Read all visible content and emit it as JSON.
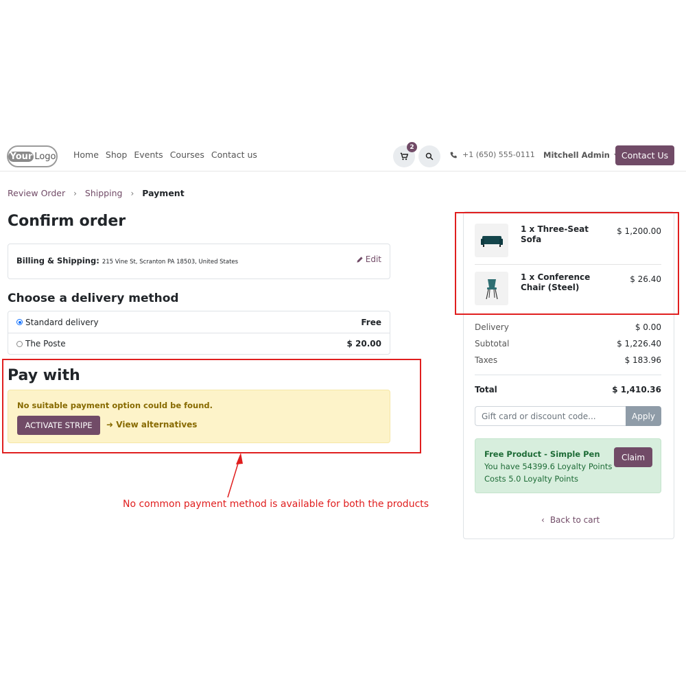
{
  "header": {
    "logo_text_a": "Your",
    "logo_text_b": "Logo",
    "nav": [
      "Home",
      "Shop",
      "Events",
      "Courses",
      "Contact us"
    ],
    "cart_count": "2",
    "phone": "+1 (650) 555-0111",
    "user": "Mitchell Admin",
    "contact_button": "Contact Us",
    "accent_color": "#714b67"
  },
  "breadcrumb": {
    "step1": "Review Order",
    "step2": "Shipping",
    "step3": "Payment"
  },
  "confirm": {
    "title": "Confirm order",
    "billing_label": "Billing & Shipping:",
    "billing_address": "215 Vine St, Scranton PA 18503, United States",
    "edit": "Edit"
  },
  "delivery": {
    "title": "Choose a delivery method",
    "methods": [
      {
        "name": "Standard delivery",
        "price": "Free",
        "selected": true
      },
      {
        "name": "The Poste",
        "price": "$ 20.00",
        "selected": false
      }
    ]
  },
  "payment": {
    "title": "Pay with",
    "message": "No suitable payment option could be found.",
    "activate_button": "ACTIVATE STRIPE",
    "alternatives_link": "View alternatives"
  },
  "annotation": "No common payment method is available for both the products",
  "summary": {
    "items": [
      {
        "name": "1 x Three-Seat Sofa",
        "price": "$ 1,200.00"
      },
      {
        "name": "1 x Conference Chair (Steel)",
        "price": "$ 26.40"
      }
    ],
    "delivery_label": "Delivery",
    "delivery_value": "$ 0.00",
    "subtotal_label": "Subtotal",
    "subtotal_value": "$ 1,226.40",
    "taxes_label": "Taxes",
    "taxes_value": "$ 183.96",
    "total_label": "Total",
    "total_value": "$ 1,410.36",
    "promo_placeholder": "Gift card or discount code...",
    "apply_button": "Apply",
    "reward": {
      "title": "Free Product - Simple Pen",
      "line1": "You have 54399.6 Loyalty Points",
      "line2": "Costs 5.0 Loyalty Points",
      "claim_button": "Claim"
    },
    "back_link": "Back to cart"
  }
}
